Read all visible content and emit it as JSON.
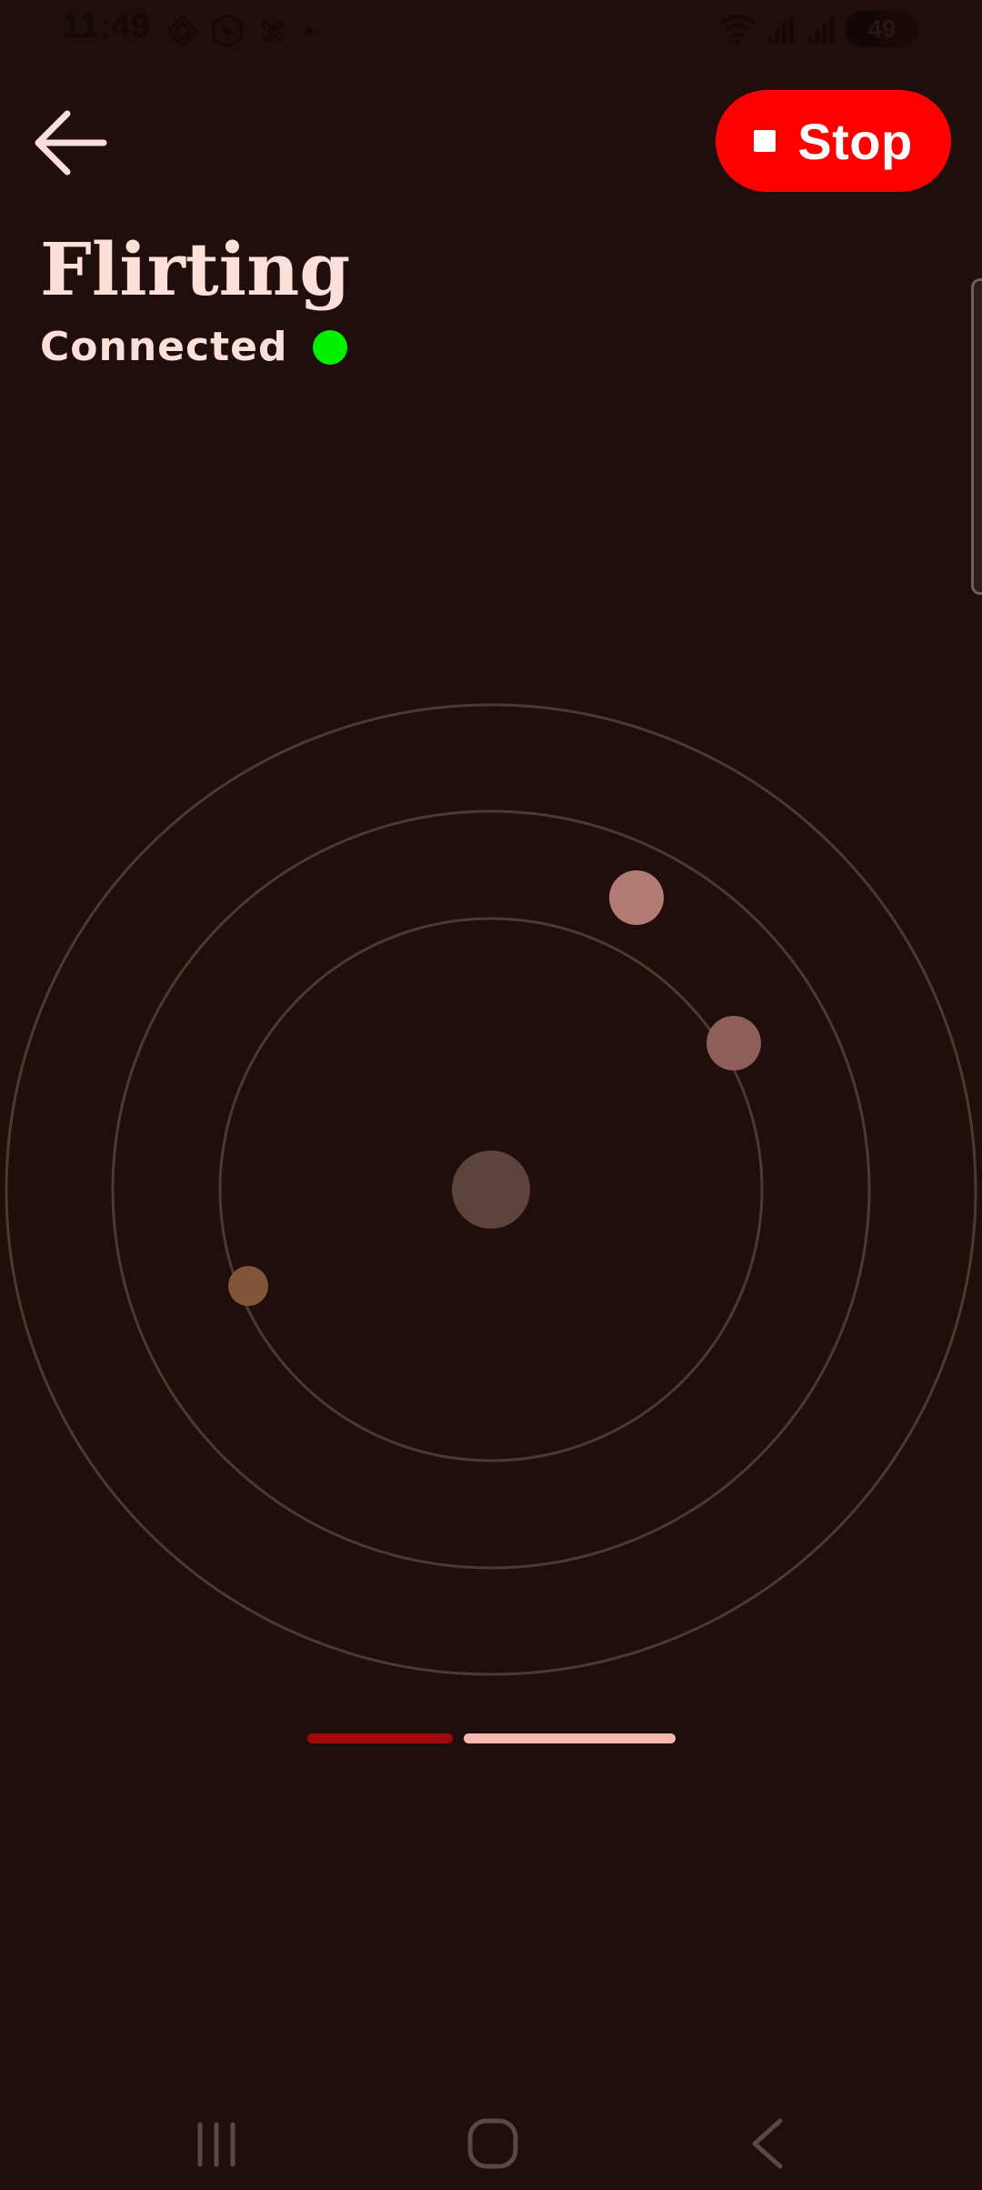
{
  "status_bar": {
    "time": "11:49",
    "battery_level": "49",
    "battery_fraction": 0.49,
    "icons_left": [
      "cube-outline-icon",
      "fan-hex-icon",
      "pinwheel-icon",
      "notification-dot-icon"
    ],
    "icons_right": [
      "wifi-icon",
      "signal-bars-icon",
      "signal-bars-icon",
      "battery-icon"
    ]
  },
  "header": {
    "back_icon": "arrow-left-icon",
    "stop_label": "Stop",
    "stop_icon": "stop-square-icon"
  },
  "session": {
    "title": "Flirting",
    "connection_label": "Connected",
    "connection_color": "#00f000"
  },
  "radar": {
    "ring_color": "#4f382f",
    "center_color": "#5e423c",
    "dots": [
      {
        "name": "radar-dot-pink",
        "color": "#b47b74"
      },
      {
        "name": "radar-dot-mauve",
        "color": "#8e5f59"
      },
      {
        "name": "radar-dot-amber",
        "color": "#80553a"
      }
    ]
  },
  "pager": {
    "total": 2,
    "active_index": 1,
    "active_color": "#f9b8af",
    "inactive_color": "#9f0b0b"
  },
  "nav": {
    "recent_icon": "recent-apps-icon",
    "home_icon": "home-icon",
    "back_icon": "back-chevron-icon"
  },
  "colors": {
    "background": "#200e0c",
    "accent": "#fe0000",
    "text": "#fddfd9"
  }
}
